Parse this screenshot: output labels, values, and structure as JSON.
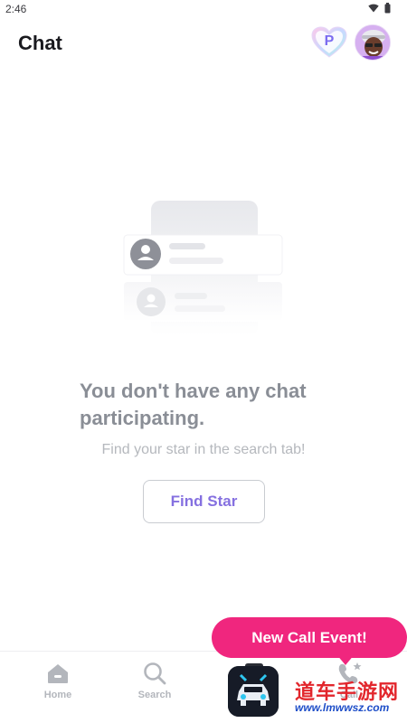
{
  "status_bar": {
    "time": "2:46"
  },
  "header": {
    "title": "Chat",
    "points_badge_letter": "P"
  },
  "empty_state": {
    "title": "You don't have any chat participating.",
    "hint": "Find your star in the search tab!",
    "button_label": "Find Star"
  },
  "nav": {
    "items": [
      {
        "label": "Home",
        "icon": "home-icon"
      },
      {
        "label": "Search",
        "icon": "search-icon"
      },
      {
        "label": "",
        "icon": "chat-icon"
      },
      {
        "label": "Call",
        "icon": "call-star-icon"
      }
    ]
  },
  "promo": {
    "call_event": "New Call Event!"
  },
  "watermark": {
    "text": "道车手游网",
    "url": "www.lmwwsz.com"
  },
  "colors": {
    "accent": "#8570e0",
    "promo": "#f0267e",
    "muted_text": "#8a8e96"
  }
}
